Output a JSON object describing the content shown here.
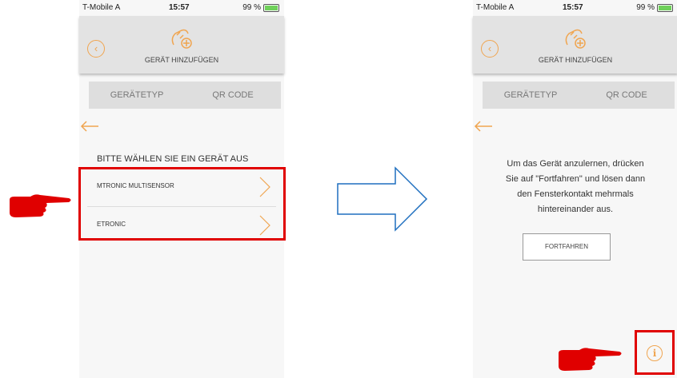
{
  "status": {
    "carrier": "T-Mobile A",
    "time": "15:57",
    "battery_left": "99 %",
    "battery_right": "99 %"
  },
  "header": {
    "title": "GERÄT HINZUFÜGEN",
    "back_icon": "back-circle-icon",
    "device_icon": "add-device-icon"
  },
  "tabs": [
    {
      "label": "GERÄTETYP"
    },
    {
      "label": "QR CODE"
    }
  ],
  "device_select": {
    "title": "BITTE WÄHLEN SIE EIN GERÄT AUS",
    "items": [
      {
        "label": "MTRONIC MULTISENSOR"
      },
      {
        "label": "ETRONIC"
      }
    ]
  },
  "instructions": {
    "lines": [
      "Um das Gerät anzulernen, drücken",
      "Sie auf \"Fortfahren\" und lösen dann",
      "den Fensterkontakt mehrmals",
      "hintereinander aus."
    ]
  },
  "continue_button": {
    "label": "FORTFAHREN"
  },
  "info_icon": {
    "glyph": "i"
  },
  "colors": {
    "accent": "#f0a550",
    "highlight": "#e00000",
    "arrow": "#1f6fbf",
    "hand": "#e00000"
  }
}
